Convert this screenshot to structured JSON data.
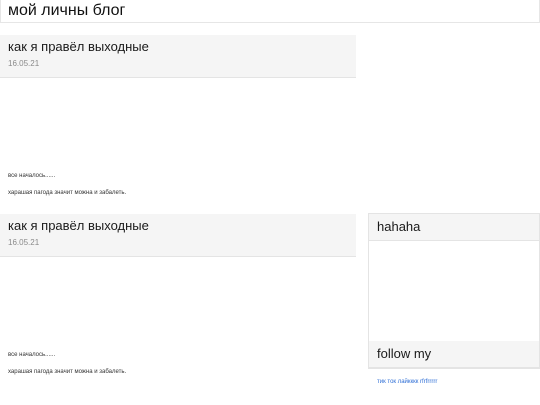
{
  "header": {
    "title": "мой личны блог"
  },
  "posts": [
    {
      "title": "как я правёл выходные",
      "date": "16.05.21",
      "paragraphs": [
        "все началось......",
        "харашая пагода значит можна и забалеть."
      ]
    },
    {
      "title": "как я правёл выходные",
      "date": "16.05.21",
      "paragraphs": [
        "все началось......",
        "харашая пагода значит можна и забалеть."
      ]
    }
  ],
  "sidebar": {
    "card_title": "hahaha",
    "follow_title": "follow my",
    "follow_link": "тик ток лайкккк rfrfrrrrr"
  },
  "colors": {
    "link": "#2f6fd6",
    "panel": "#f5f5f5",
    "date": "#8a8a8a"
  }
}
